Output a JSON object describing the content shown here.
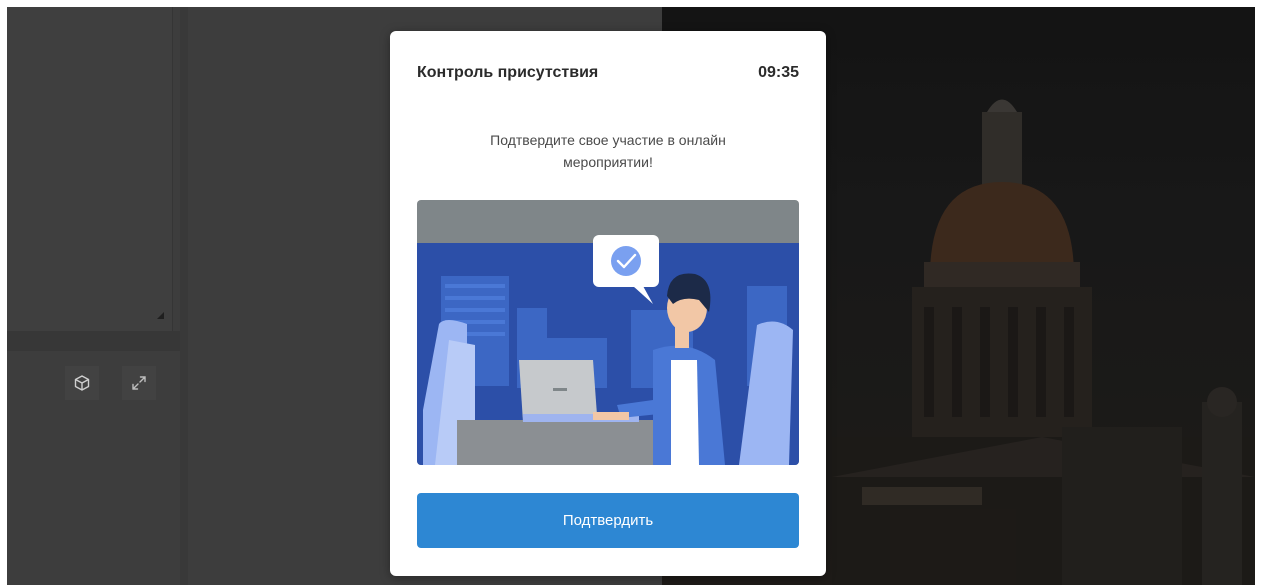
{
  "modal": {
    "title": "Контроль присутствия",
    "timer": "09:35",
    "message": "Подтвердите свое участие в онлайн мероприятии!",
    "confirm_label": "Подтвердить",
    "illustration_icon": "checkmark-speech-bubble"
  },
  "toolbar": {
    "items": [
      {
        "icon": "cube-icon"
      },
      {
        "icon": "expand-icon"
      }
    ]
  },
  "colors": {
    "accent": "#2d87d3",
    "backdrop": "#3d3d3d",
    "illustration_blue": "#2c4fa8",
    "illustration_gray": "#7f8689"
  }
}
